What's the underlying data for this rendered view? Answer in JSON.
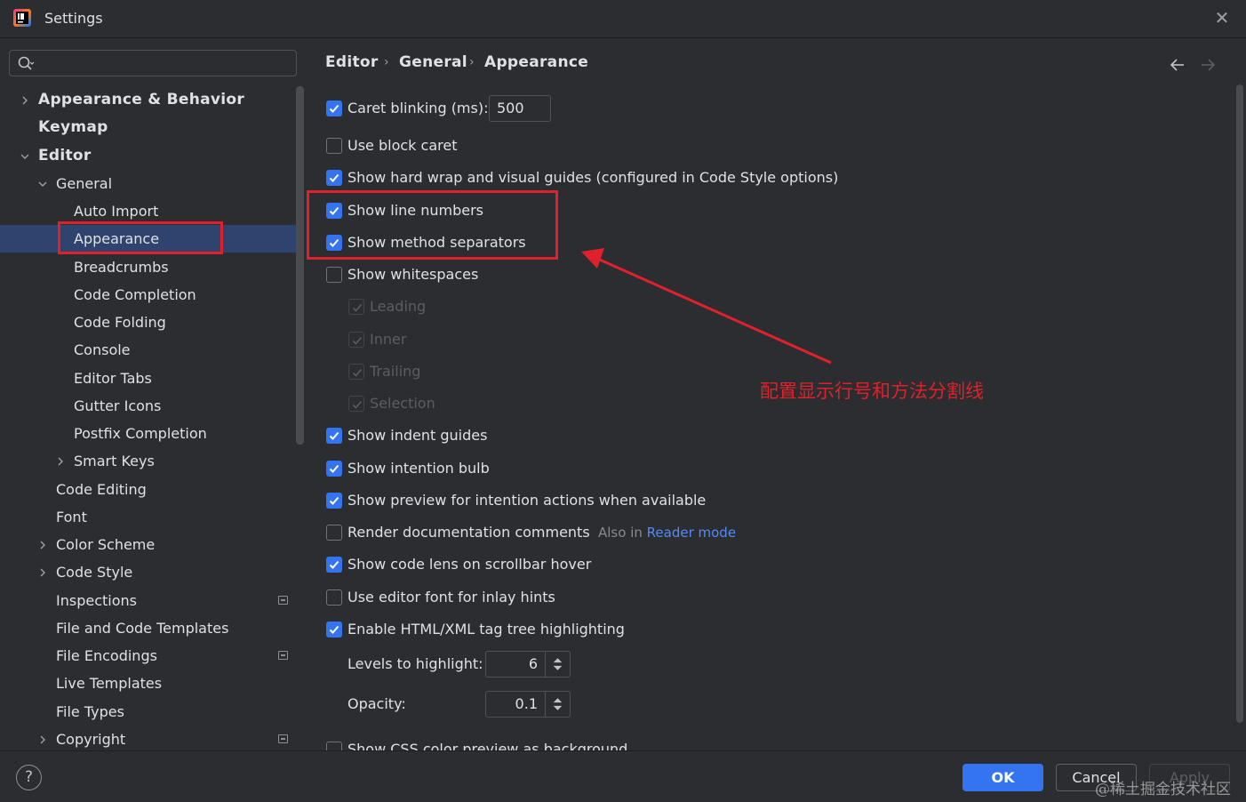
{
  "window": {
    "title": "Settings",
    "icon": "intellij-app-icon",
    "close_icon": "close-icon"
  },
  "search": {
    "placeholder": "",
    "value": "",
    "icon": "search-icon"
  },
  "tree": {
    "items": [
      {
        "label": "Appearance & Behavior",
        "level": 0,
        "expandable": true,
        "expanded": false,
        "bold": true
      },
      {
        "label": "Keymap",
        "level": 0,
        "expandable": false,
        "bold": true
      },
      {
        "label": "Editor",
        "level": 0,
        "expandable": true,
        "expanded": true,
        "bold": true
      },
      {
        "label": "General",
        "level": 1,
        "expandable": true,
        "expanded": true
      },
      {
        "label": "Auto Import",
        "level": 2
      },
      {
        "label": "Appearance",
        "level": 2,
        "selected": true
      },
      {
        "label": "Breadcrumbs",
        "level": 2
      },
      {
        "label": "Code Completion",
        "level": 2
      },
      {
        "label": "Code Folding",
        "level": 2
      },
      {
        "label": "Console",
        "level": 2
      },
      {
        "label": "Editor Tabs",
        "level": 2
      },
      {
        "label": "Gutter Icons",
        "level": 2
      },
      {
        "label": "Postfix Completion",
        "level": 2
      },
      {
        "label": "Smart Keys",
        "level": 2,
        "expandable": true,
        "expanded": false
      },
      {
        "label": "Code Editing",
        "level": 1
      },
      {
        "label": "Font",
        "level": 1
      },
      {
        "label": "Color Scheme",
        "level": 1,
        "expandable": true,
        "expanded": false
      },
      {
        "label": "Code Style",
        "level": 1,
        "expandable": true,
        "expanded": false
      },
      {
        "label": "Inspections",
        "level": 1,
        "badge": true
      },
      {
        "label": "File and Code Templates",
        "level": 1
      },
      {
        "label": "File Encodings",
        "level": 1,
        "badge": true
      },
      {
        "label": "Live Templates",
        "level": 1
      },
      {
        "label": "File Types",
        "level": 1
      },
      {
        "label": "Copyright",
        "level": 1,
        "expandable": true,
        "expanded": false,
        "badge": true
      }
    ]
  },
  "breadcrumb": {
    "items": [
      "Editor",
      "General",
      "Appearance"
    ],
    "separator": "›"
  },
  "nav": {
    "back_icon": "arrow-left-icon",
    "forward_icon": "arrow-right-icon"
  },
  "options": {
    "caret_blinking": {
      "label": "Caret blinking (ms):",
      "checked": true,
      "value": "500"
    },
    "block_caret": {
      "label": "Use block caret",
      "checked": false
    },
    "hard_wrap": {
      "label": "Show hard wrap and visual guides (configured in Code Style options)",
      "checked": true
    },
    "line_numbers": {
      "label": "Show line numbers",
      "checked": true
    },
    "method_separators": {
      "label": "Show method separators",
      "checked": true
    },
    "whitespaces": {
      "label": "Show whitespaces",
      "checked": false
    },
    "leading": {
      "label": "Leading",
      "checked": true,
      "disabled": true
    },
    "inner": {
      "label": "Inner",
      "checked": true,
      "disabled": true
    },
    "trailing": {
      "label": "Trailing",
      "checked": true,
      "disabled": true
    },
    "selection": {
      "label": "Selection",
      "checked": true,
      "disabled": true
    },
    "indent_guides": {
      "label": "Show indent guides",
      "checked": true
    },
    "intention_bulb": {
      "label": "Show intention bulb",
      "checked": true
    },
    "preview_intention": {
      "label": "Show preview for intention actions when available",
      "checked": true
    },
    "render_docs": {
      "label": "Render documentation comments",
      "checked": false,
      "hint_prefix": "Also in",
      "hint_link": "Reader mode"
    },
    "code_lens": {
      "label": "Show code lens on scrollbar hover",
      "checked": true
    },
    "inlay_font": {
      "label": "Use editor font for inlay hints",
      "checked": false
    },
    "tag_tree": {
      "label": "Enable HTML/XML tag tree highlighting",
      "checked": true
    },
    "levels": {
      "label": "Levels to highlight:",
      "value": "6"
    },
    "opacity": {
      "label": "Opacity:",
      "value": "0.1"
    },
    "css_color": {
      "label": "Show CSS color preview as background",
      "checked": false
    }
  },
  "annotation": {
    "text": "配置显示行号和方法分割线",
    "color": "#e0212b"
  },
  "footer": {
    "help_label": "?",
    "ok_label": "OK",
    "cancel_label": "Cancel",
    "apply_label": "Apply",
    "watermark": "@稀土掘金技术社区"
  },
  "colors": {
    "accent": "#3574f0",
    "background": "#2b2d30",
    "selection": "#2e436e",
    "annotation_red": "#e0212b"
  }
}
